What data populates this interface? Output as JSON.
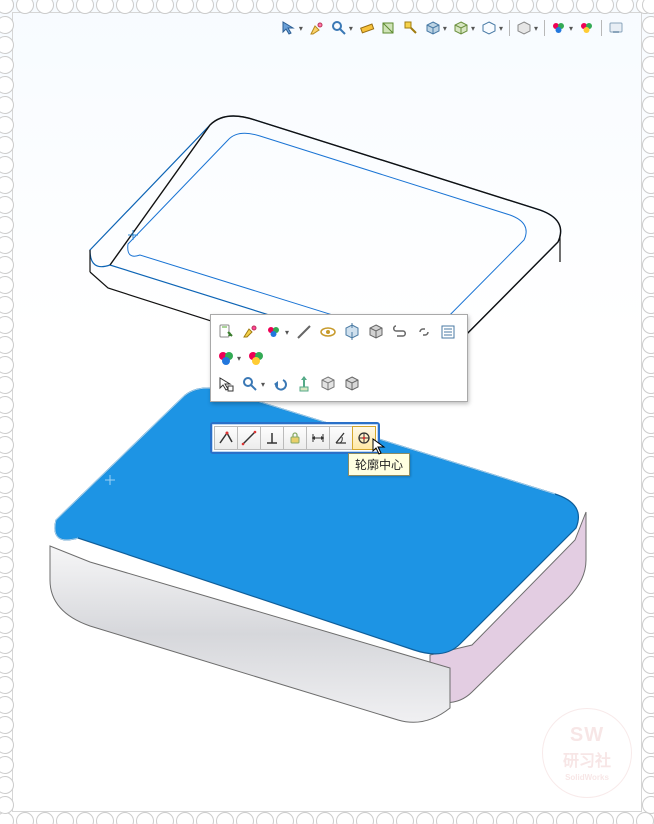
{
  "tooltip": {
    "profileCenter": "轮廓中心"
  },
  "watermark": {
    "line1": "SW",
    "line2": "研习社",
    "line3": "SolidWorks"
  },
  "hud": {
    "icons": [
      "select-over-geometry-icon",
      "highlight-icon",
      "magnifier-icon",
      "measure-icon",
      "section-icon",
      "appearance-icon",
      "cube-view-icon",
      "view-orientation-icon",
      "display-style-icon",
      "hide-show-icon",
      "view-icon",
      "render-tools-icon",
      "apply-scene-icon",
      "edit-appearance-icon",
      "display-pane-icon"
    ]
  },
  "ctx": {
    "row1": [
      "paste-icon",
      "brush-icon",
      "colorwheel-icon",
      "line-icon",
      "eye-icon",
      "normal-to-icon",
      "cube-icon",
      "clip-icon",
      "link-icon",
      "list-icon"
    ],
    "row2": [
      "rgb-balls-icon",
      "single-ball-icon"
    ],
    "row3": [
      "cursor-select-icon",
      "zoom-icon",
      "undo-icon",
      "move-icon",
      "box-icon",
      "box2-icon"
    ]
  },
  "relations": {
    "buttons": [
      "coincident-relation-icon",
      "horizontal-relation-icon",
      "perpendicular-relation-icon",
      "fix-relation-icon",
      "dimension-relation-icon",
      "angle-relation-icon",
      "profile-center-relation-icon"
    ]
  },
  "scene": {
    "origin_cross": true
  }
}
